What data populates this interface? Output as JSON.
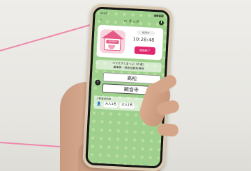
{
  "phone_app": {
    "status_bar": {
      "time": "12:28"
    },
    "header": {
      "title": "きっぷ",
      "back_icon": "chevron-left-icon",
      "info_icon": "info-icon"
    },
    "ticket": {
      "label": "使用中",
      "time": "10:28:48",
      "use_button": "使用終了",
      "mascot_sign": "AD BUS"
    },
    "ticket_info": {
      "line1": "スマえきくまっぷ（片道）",
      "line2": "乗車券・特急回数利用券"
    },
    "route": {
      "from": "高松",
      "to": "観音寺"
    },
    "passengers": {
      "label": "人数選択内容",
      "adult": "大人1名",
      "child": "大人1名"
    }
  },
  "colors": {
    "app_background": "#9fd08e",
    "accent_pink": "#e0266f",
    "annotation_line": "#ee88ad"
  }
}
